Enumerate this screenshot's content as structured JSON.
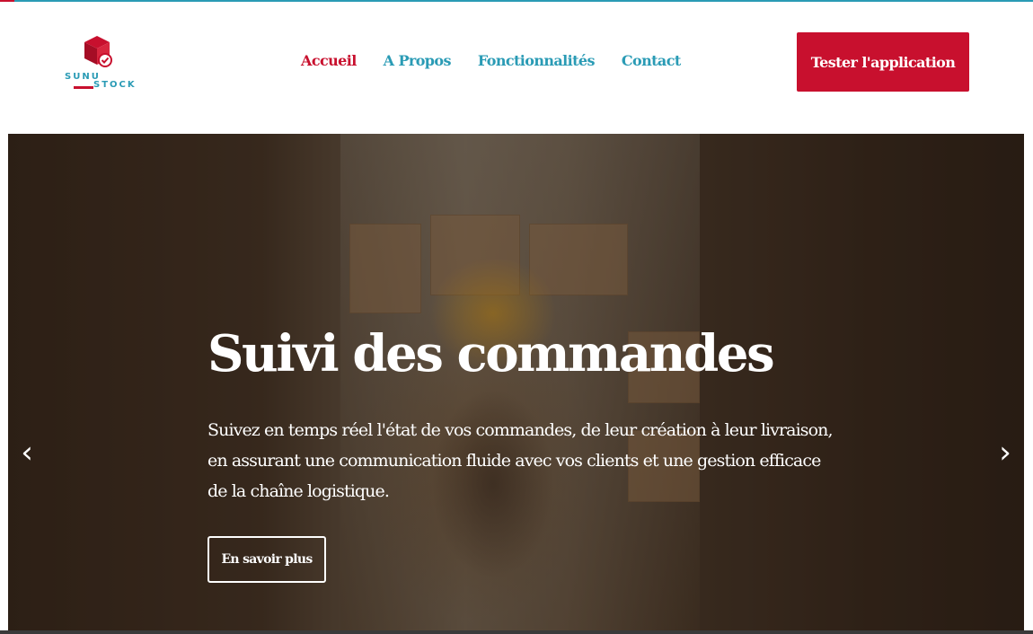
{
  "brand": {
    "word1": "SUNU",
    "word2": "STOCK",
    "icon": "box-check-icon",
    "primary_color": "#c8102e",
    "accent_color": "#2a9bb5"
  },
  "nav": {
    "items": [
      {
        "label": "Accueil",
        "active": true
      },
      {
        "label": "A Propos",
        "active": false
      },
      {
        "label": "Fonctionnalités",
        "active": false
      },
      {
        "label": "Contact",
        "active": false
      }
    ]
  },
  "header": {
    "cta_label": "Tester l'application"
  },
  "hero": {
    "title": "Suivi des commandes",
    "description": "Suivez en temps réel l'état de vos commandes, de leur création à leur livraison, en assurant une communication fluide avec vos clients et une gestion efficace de la chaîne logistique.",
    "button_label": "En savoir plus",
    "prev_icon": "‹",
    "next_icon": "›"
  }
}
